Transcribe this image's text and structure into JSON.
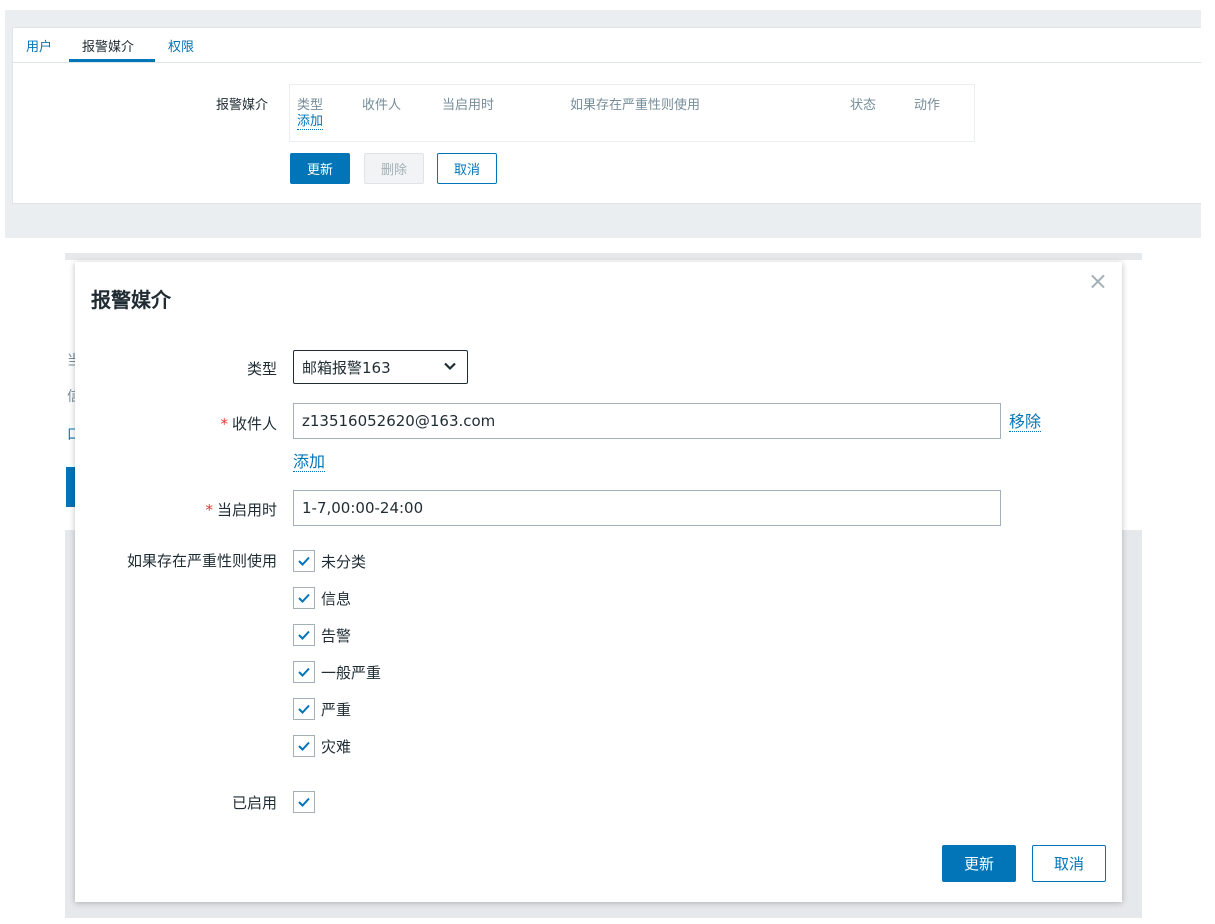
{
  "tabs": [
    {
      "label": "用户"
    },
    {
      "label": "报警媒介"
    },
    {
      "label": "权限"
    }
  ],
  "media_section": {
    "label": "报警媒介",
    "columns": [
      "类型",
      "收件人",
      "当启用时",
      "如果存在严重性则使用",
      "状态",
      "动作"
    ],
    "add_link": "添加"
  },
  "page_buttons": {
    "update": "更新",
    "delete": "删除",
    "cancel": "取消"
  },
  "modal": {
    "title": "报警媒介",
    "close": "×",
    "type_label": "类型",
    "type_value": "邮箱报警163",
    "recipient_label": "收件人",
    "recipient_value": "z13516052620@163.com",
    "remove_link": "移除",
    "add_link": "添加",
    "when_active_label": "当启用时",
    "when_active_value": "1-7,00:00-24:00",
    "severity_label": "如果存在严重性则使用",
    "severities": [
      {
        "label": "未分类",
        "checked": true
      },
      {
        "label": "信息",
        "checked": true
      },
      {
        "label": "告警",
        "checked": true
      },
      {
        "label": "一般严重",
        "checked": true
      },
      {
        "label": "严重",
        "checked": true
      },
      {
        "label": "灾难",
        "checked": true
      }
    ],
    "enabled_label": "已启用",
    "enabled": true,
    "update_button": "更新",
    "cancel_button": "取消"
  },
  "colors": {
    "accent": "#0275b8",
    "required": "#e33734",
    "text": "#1f2c33",
    "muted": "#768d99"
  }
}
